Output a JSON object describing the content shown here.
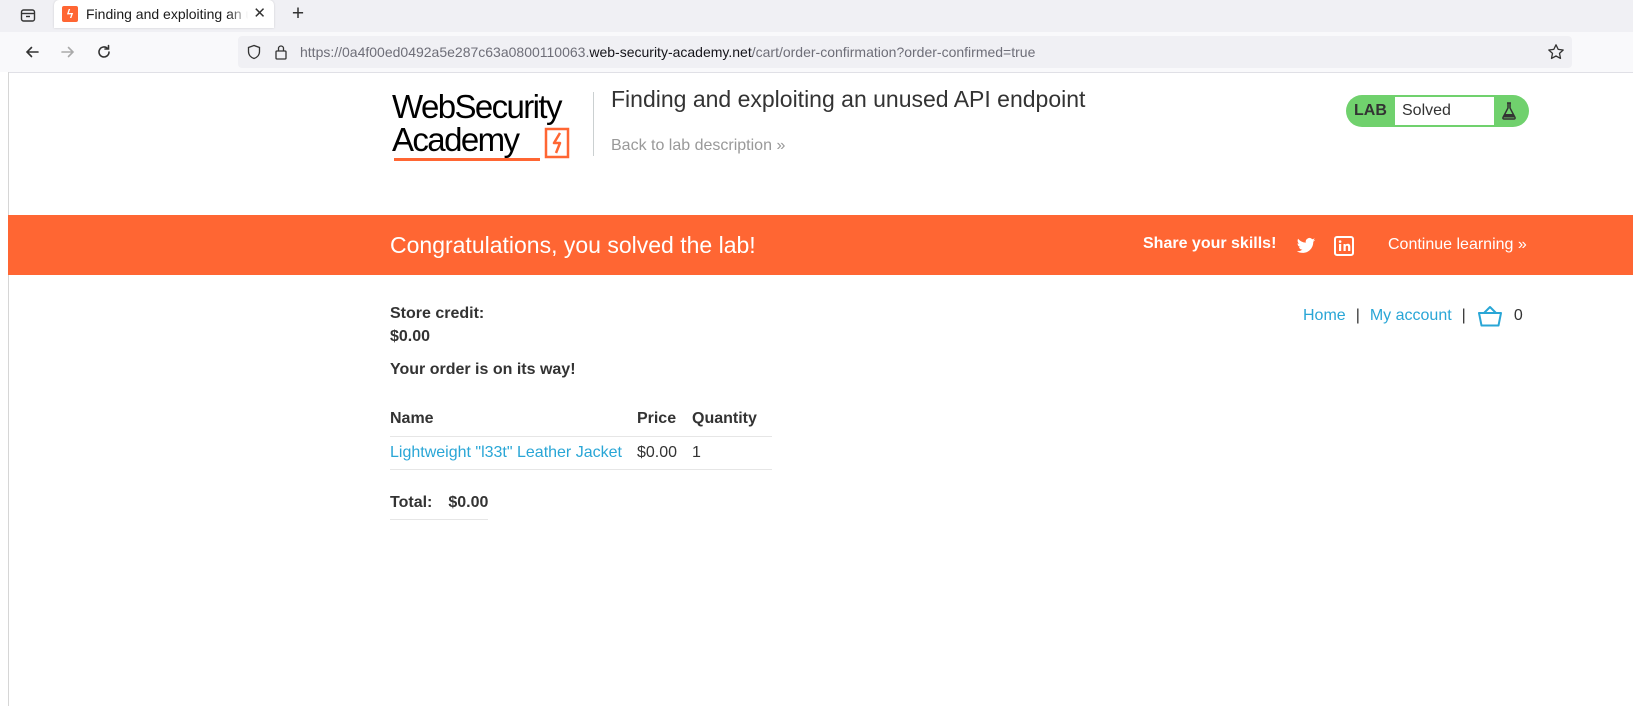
{
  "browser": {
    "tab_title": "Finding and exploiting an unused API endpoint",
    "url_prefix": "https://0a4f00ed0492a5e287c63a0800110063.",
    "url_domain": "web-security-academy.net",
    "url_path": "/cart/order-confirmation?order-confirmed=true"
  },
  "header": {
    "logo_line1": "WebSecurity",
    "logo_line2": "Academy",
    "lab_title": "Finding and exploiting an unused API endpoint",
    "back_link": "Back to lab description",
    "lab_badge": "LAB",
    "lab_status": "Solved"
  },
  "banner": {
    "message": "Congratulations, you solved the lab!",
    "share": "Share your skills!",
    "continue": "Continue learning"
  },
  "account_nav": {
    "home": "Home",
    "my_account": "My account",
    "separator": "|",
    "cart_count": "0"
  },
  "content": {
    "store_credit_label": "Store credit:",
    "store_credit_value": "$0.00",
    "order_message": "Your order is on its way!",
    "columns": [
      "Name",
      "Price",
      "Quantity"
    ],
    "rows": [
      {
        "name": "Lightweight \"l33t\" Leather Jacket",
        "price": "$0.00",
        "quantity": "1"
      }
    ],
    "total_label": "Total:",
    "total_value": "$0.00"
  },
  "colors": {
    "accent": "#ff6633",
    "link": "#29a6d6",
    "solved": "#70d16d"
  }
}
